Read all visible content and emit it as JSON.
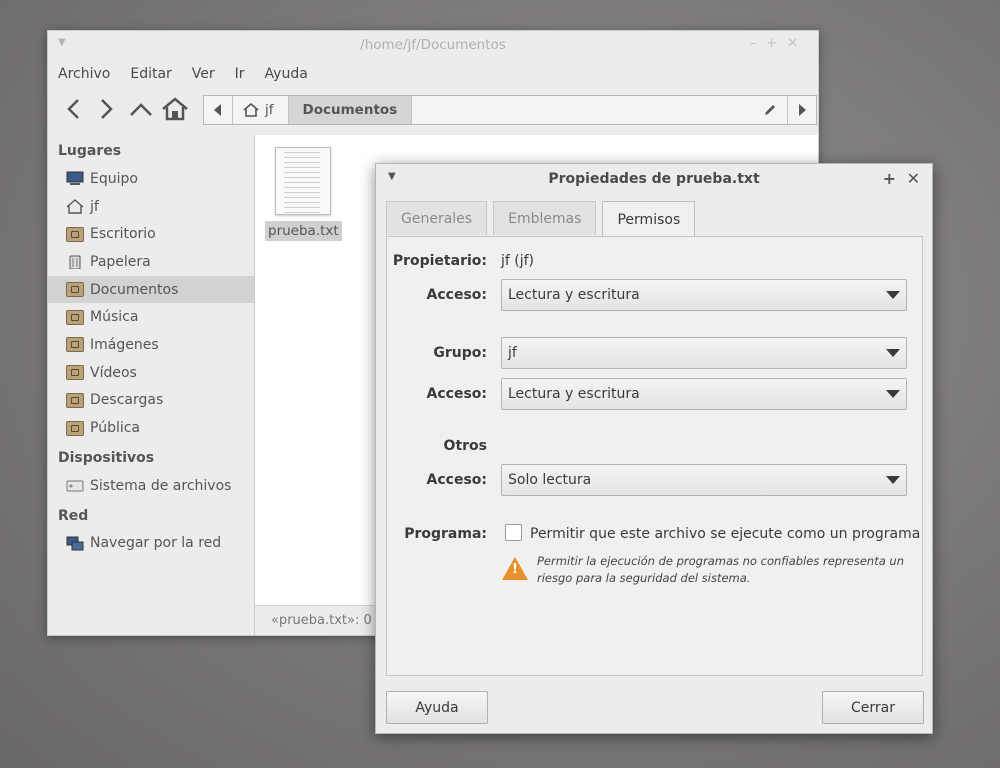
{
  "file_manager": {
    "title": "/home/jf/Documentos",
    "menu": [
      "Archivo",
      "Editar",
      "Ver",
      "Ir",
      "Ayuda"
    ],
    "path": {
      "home": "jf",
      "current": "Documentos"
    },
    "sidebar": {
      "places_header": "Lugares",
      "places": [
        {
          "label": "Equipo",
          "icon": "computer-icon"
        },
        {
          "label": "jf",
          "icon": "home-icon"
        },
        {
          "label": "Escritorio",
          "icon": "folder-icon"
        },
        {
          "label": "Papelera",
          "icon": "trash-icon"
        },
        {
          "label": "Documentos",
          "icon": "folder-icon",
          "selected": true
        },
        {
          "label": "Música",
          "icon": "folder-icon"
        },
        {
          "label": "Imágenes",
          "icon": "folder-icon"
        },
        {
          "label": "Vídeos",
          "icon": "folder-icon"
        },
        {
          "label": "Descargas",
          "icon": "folder-icon"
        },
        {
          "label": "Pública",
          "icon": "folder-icon"
        }
      ],
      "devices_header": "Dispositivos",
      "devices": [
        {
          "label": "Sistema de archivos",
          "icon": "drive-icon"
        }
      ],
      "network_header": "Red",
      "network": [
        {
          "label": "Navegar por la red",
          "icon": "network-icon"
        }
      ]
    },
    "files": [
      {
        "name": "prueba.txt",
        "icon": "text-file-icon"
      }
    ],
    "status": "«prueba.txt»: 0"
  },
  "dialog": {
    "title": "Propiedades de prueba.txt",
    "tabs": [
      "Generales",
      "Emblemas",
      "Permisos"
    ],
    "active_tab": "Permisos",
    "owner_label": "Propietario:",
    "owner_value": "jf (jf)",
    "access_label": "Acceso:",
    "owner_access": "Lectura y escritura",
    "group_label": "Grupo:",
    "group_value": "jf",
    "group_access": "Lectura y escritura",
    "others_label": "Otros",
    "others_access": "Solo lectura",
    "program_label": "Programa:",
    "program_checkbox": "Permitir que este archivo se ejecute como un programa",
    "warning": "Permitir la ejecución de programas no confiables representa un riesgo para la seguridad del sistema.",
    "help_button": "Ayuda",
    "close_button": "Cerrar"
  }
}
